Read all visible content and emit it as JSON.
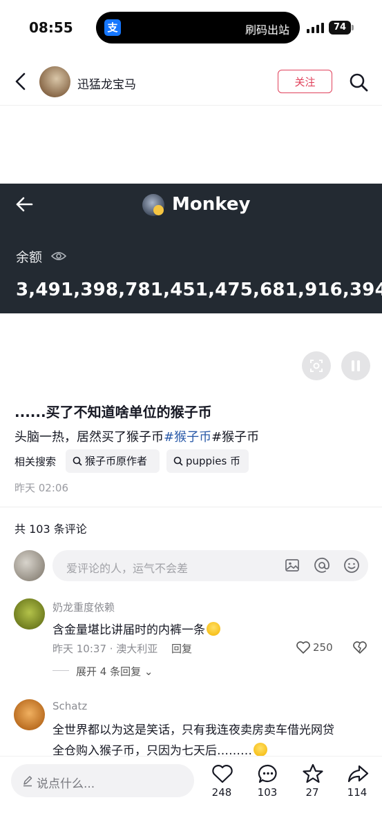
{
  "status_bar": {
    "time": "08:55",
    "island_icon": "支",
    "island_text": "刷码出站",
    "battery": "74"
  },
  "header": {
    "author": "迅猛龙宝马",
    "follow_label": "关注"
  },
  "wallet": {
    "title": "Monkey",
    "balance_label": "余额",
    "balance_value": "3,491,398,781,451,475,681,916,394"
  },
  "post": {
    "title": "......买了不知道啥单位的猴子币",
    "desc_prefix": "头脑一热，居然买了猴子币",
    "hashtag1": "#猴子币",
    "hashtag2": "#猴子币",
    "related_label": "相关搜索",
    "related_chips": [
      "猴子币原作者",
      "puppies 币"
    ],
    "time": "昨天 02:06"
  },
  "comments": {
    "count_text": "共 103 条评论",
    "input_placeholder": "爱评论的人，运气不会差",
    "items": [
      {
        "name": "奶龙重度依赖",
        "text": "含金量堪比讲届时的内裤一条",
        "meta": "昨天 10:37 · 澳大利亚",
        "reply": "回复",
        "likes": "250",
        "expand": "展开 4 条回复"
      },
      {
        "name": "Schatz",
        "line1": "全世界都以为这是笑话，只有我连夜卖房卖车借光网贷",
        "line2": "全仓购入猴子币，只因为七天后………"
      }
    ]
  },
  "bottom_bar": {
    "input_placeholder": "说点什么...",
    "likes": "248",
    "comments": "103",
    "favorites": "27",
    "shares": "114"
  },
  "colors": {
    "accent_red": "#e0405a",
    "hashtag_blue": "#2a5aa8",
    "panel_dark": "#232a32"
  }
}
